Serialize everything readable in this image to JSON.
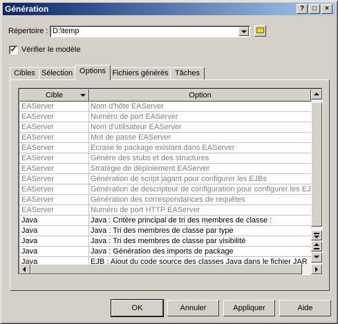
{
  "window": {
    "title": "Génération",
    "controls": [
      "?",
      "□",
      "×"
    ]
  },
  "directory": {
    "label": "Répertoire :",
    "value": "D:\\temp",
    "icon": "folder-icon"
  },
  "verify": {
    "label": "Vérifier le modèle",
    "checked": true
  },
  "tabs": [
    {
      "label": "Cibles",
      "active": false
    },
    {
      "label": "Sélection",
      "active": false
    },
    {
      "label": "Options",
      "active": true
    },
    {
      "label": "Fichiers générés",
      "active": false
    },
    {
      "label": "Tâches",
      "active": false
    }
  ],
  "grid": {
    "headers": {
      "col1": "Cible",
      "col2": "Option"
    },
    "rows": [
      {
        "cible": "EAServer",
        "option": "Nom d'hôte EAServer"
      },
      {
        "cible": "EAServer",
        "option": "Numéro de port EAServer"
      },
      {
        "cible": "EAServer",
        "option": "Nom d'utilisateur EAServer"
      },
      {
        "cible": "EAServer",
        "option": "Mot de passe EAServer"
      },
      {
        "cible": "EAServer",
        "option": "Ecrase le package existant dans EAServer"
      },
      {
        "cible": "EAServer",
        "option": "Génère des stubs et des structures"
      },
      {
        "cible": "EAServer",
        "option": "Stratégie de déploiement EAServer"
      },
      {
        "cible": "EAServer",
        "option": "Génération de script jagant pour configurer les EJBs"
      },
      {
        "cible": "EAServer",
        "option": "Génération de descripteur de configuration pour configurer les EJB"
      },
      {
        "cible": "EAServer",
        "option": "Génération des correspondances de requêtes"
      },
      {
        "cible": "EAServer",
        "option": "Numéro de port HTTP EAServer"
      },
      {
        "cible": "Java",
        "option": "Java : Critère principal de tri des membres de classe :"
      },
      {
        "cible": "Java",
        "option": "Java : Tri des membres de classe par type"
      },
      {
        "cible": "Java",
        "option": "Java : Tri des membres de classe par visibilité"
      },
      {
        "cible": "Java",
        "option": "Java : Génération des imports de package"
      },
      {
        "cible": "Java",
        "option": "EJB : Ajout du code source des classes Java dans le fichier JAR"
      }
    ]
  },
  "buttons": {
    "ok": "OK",
    "cancel": "Annuler",
    "apply": "Appliquer",
    "help": "Aide"
  },
  "colors": {
    "title_gradient_start": "#0a246a",
    "title_gradient_end": "#a6caf0",
    "face": "#d4d0c8",
    "disabled_text": "#808080"
  }
}
